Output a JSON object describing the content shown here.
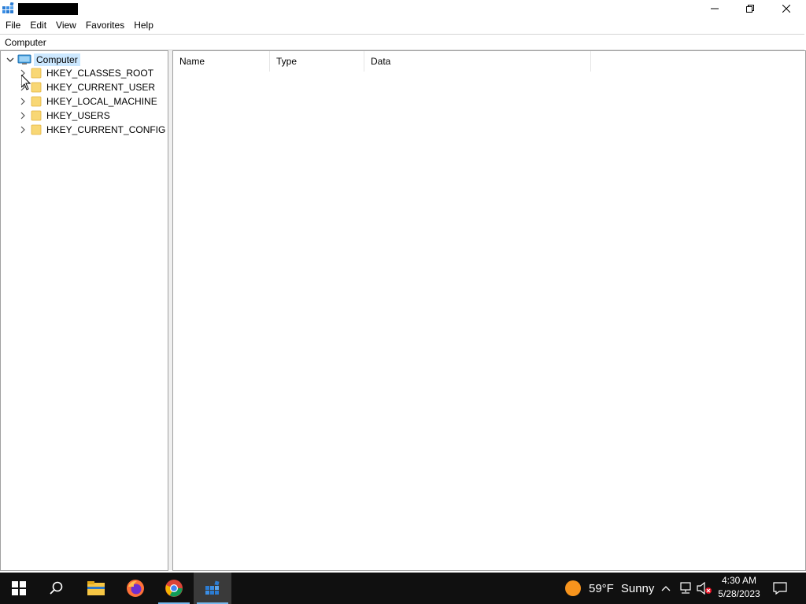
{
  "window": {
    "title": "",
    "controls": {
      "minimize": "minimize",
      "maximize": "restore",
      "close": "close"
    }
  },
  "menu": [
    "File",
    "Edit",
    "View",
    "Favorites",
    "Help"
  ],
  "address": {
    "path": "Computer"
  },
  "tree": {
    "root": {
      "label": "Computer",
      "expanded": true,
      "selected": true
    },
    "hives": [
      "HKEY_CLASSES_ROOT",
      "HKEY_CURRENT_USER",
      "HKEY_LOCAL_MACHINE",
      "HKEY_USERS",
      "HKEY_CURRENT_CONFIG"
    ]
  },
  "list": {
    "columns": [
      "Name",
      "Type",
      "Data"
    ]
  },
  "taskbar": {
    "apps": [
      "start-icon",
      "search-icon",
      "file-explorer-icon",
      "firefox-icon",
      "chrome-icon",
      "registry-editor-icon"
    ],
    "weather": {
      "temp": "59°F",
      "condition": "Sunny"
    },
    "clock": {
      "time": "4:30 AM",
      "date": "5/28/2023"
    }
  },
  "colors": {
    "selection": "#cce8ff",
    "taskbar": "#101010",
    "folder": "#f8d775",
    "accent": "#76b9ed",
    "weather_sun": "#f7941d"
  }
}
